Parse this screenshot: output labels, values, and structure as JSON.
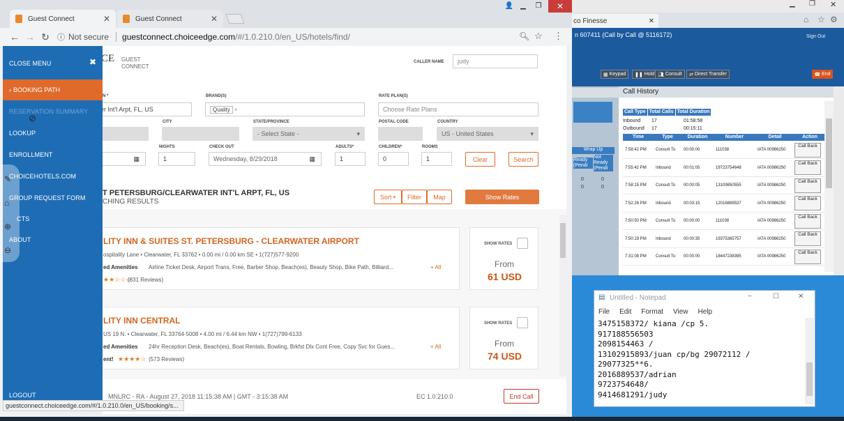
{
  "browser": {
    "tabs": [
      {
        "title": "Guest Connect",
        "close": "✕"
      },
      {
        "title": "Guest Connect",
        "close": "✕"
      }
    ],
    "not_secure": "Not secure",
    "url_host": "guestconnect.choiceedge.com",
    "url_path": "/#/1.0.210.0/en_US/hotels/find/",
    "status_url": "guestconnect.choiceedge.com/#/1.0.210.0/en_US/booking/s..."
  },
  "side_menu": {
    "close": "CLOSE MENU",
    "items": [
      "BOOKING PATH",
      "RESERVATION SUMMARY",
      "LOOKUP",
      "ENROLLMENT",
      "CHOICEHOTELS.COM",
      "GROUP REQUEST FORM",
      "CTS",
      "ABOUT"
    ],
    "logout": "LOGOUT"
  },
  "header": {
    "logo_partial": "CE",
    "app_name_1": "GUEST",
    "app_name_2": "CONNECT",
    "caller_name_label": "CALLER NAME",
    "caller_name_value": "judy"
  },
  "search": {
    "destination_label": "N *",
    "destination_value": "er Int'l Arpt, FL, US",
    "brands_label": "BRAND(S)",
    "brand_chip": "Quality",
    "rate_plans_label": "RATE PLAN(S)",
    "rate_plans_placeholder": "Choose Rate Plans",
    "city_label": "CITY",
    "state_label": "STATE/PROVINCE",
    "state_value": "- Select State -",
    "postal_label": "POSTAL CODE",
    "country_label": "COUNTRY",
    "country_value": "US - United States",
    "nights_label": "NIGHTS",
    "nights_value": "1",
    "checkout_label": "CHECK OUT",
    "checkout_value": "Wednesday, 8/29/2018",
    "adults_label": "ADULTS*",
    "adults_value": "1",
    "children_label": "CHILDREN*",
    "children_value": "0",
    "rooms_label": "ROOMS",
    "rooms_value": "1",
    "clear": "Clear",
    "search": "Search"
  },
  "results": {
    "title": "T PETERSBURG/CLEARWATER INT'L ARPT, FL, US",
    "subtitle": "CHING RESULTS",
    "sort": "Sort",
    "filter": "Filter",
    "map": "Map",
    "show_rates": "Show Rates",
    "hotels": [
      {
        "name": "LITY INN & SUITES ST. PETERSBURG - CLEARWATER AIRPORT",
        "address": "ospitality Lane  •  Clearwater, FL 33762  •  0.00 mi / 0.00 km SE  •  1(727)577-9200",
        "amen_label": "ed Amenities",
        "amenities": "Airline Ticket Desk, Airport Trans, Free, Barber Shop, Beach(es), Beauty Shop, Bike Path, Billiard...",
        "more": "+ All",
        "stars": "★★☆☆☆",
        "reviews": "(831 Reviews)",
        "show_rates": "SHOW RATES",
        "from": "From",
        "price": "61 USD"
      },
      {
        "name": "LITY INN CENTRAL",
        "address": "US 19 N.  •  Clearwater, FL 33764-5008  •  4.00 mi / 6.44 km NW  •  1(727)799-6133",
        "amen_label": "ed Amenities",
        "amenities": "24hr Reception Desk, Beach(es), Boat Rentals, Bowling, Brkfst Dlx Cont Free, Copy Svc for Gues...",
        "more": "+ All",
        "extra": "ent!",
        "stars": "★★★★☆",
        "reviews": "(573 Reviews)",
        "show_rates": "SHOW RATES",
        "from": "From",
        "price": "74 USD"
      }
    ]
  },
  "footer": {
    "info": "MNLRC - RA - August 27, 2018 11:15:38 AM  |  GMT - 3:15:38 AM",
    "version": "EC 1.0.210.0",
    "end_call": "End Call"
  },
  "finesse": {
    "tab": "co Finesse",
    "call": "n 607411 (Call by Call @ 5116172)",
    "signout": "Sign Out",
    "buttons": [
      "Keypad",
      "Hold",
      "Consult",
      "Direct Transfer"
    ],
    "end": "End",
    "call_history": "Call History",
    "summary_headers": [
      "Call Type",
      "Total Calls",
      "Total Duration"
    ],
    "summary_rows": [
      [
        "Inbound",
        "17",
        "01:58:58"
      ],
      [
        "Outbound",
        "17",
        "00:15:11"
      ]
    ],
    "wrap_up": "Wrap Up",
    "ready": "Ready (Pendi",
    "not_ready": "Not Ready (Pendi",
    "wr_values": [
      "0",
      "0",
      "0",
      "0"
    ],
    "columns": [
      "Time",
      "Type",
      "Duration",
      "Number",
      "Detail",
      "Action"
    ],
    "rows": [
      [
        "7:58:42 PM",
        "Consult To",
        "00:00:00",
        "111038",
        "IATA 00986250",
        "Call Back"
      ],
      [
        "7:55:42 PM",
        "Inbound",
        "00:01:05",
        "19723754648",
        "IATA 00986250",
        "Call Back"
      ],
      [
        "7:58:15 PM",
        "Consult To",
        "00:00:05",
        "13109850555",
        "IATA 00986250",
        "Call Back"
      ],
      [
        "7:52:26 PM",
        "Inbound",
        "00:03:15",
        "12016889537",
        "IATA 00986250",
        "Call Back"
      ],
      [
        "7:50:50 PM",
        "Consult To",
        "00:00:00",
        "111038",
        "IATA 00986250",
        "Call Back"
      ],
      [
        "7:50:19 PM",
        "Inbound",
        "00:00:35",
        "19375365757",
        "IATA 00986250",
        "Call Back"
      ],
      [
        "7:31:08 PM",
        "Consult To",
        "00:00:00",
        "18447238395",
        "IATA 00986250",
        "Call Back"
      ]
    ]
  },
  "notepad": {
    "title": "Untitled - Notepad",
    "menu": [
      "File",
      "Edit",
      "Format",
      "View",
      "Help"
    ],
    "lines": [
      "3475158372/ kiana /cp 5.",
      "917188556503",
      "2098154463 /",
      "13102915893/juan cp/bg 29072112 /",
      "29077325**6.",
      "2016889537/adrian",
      "9723754648/",
      "9414681291/judy"
    ]
  }
}
